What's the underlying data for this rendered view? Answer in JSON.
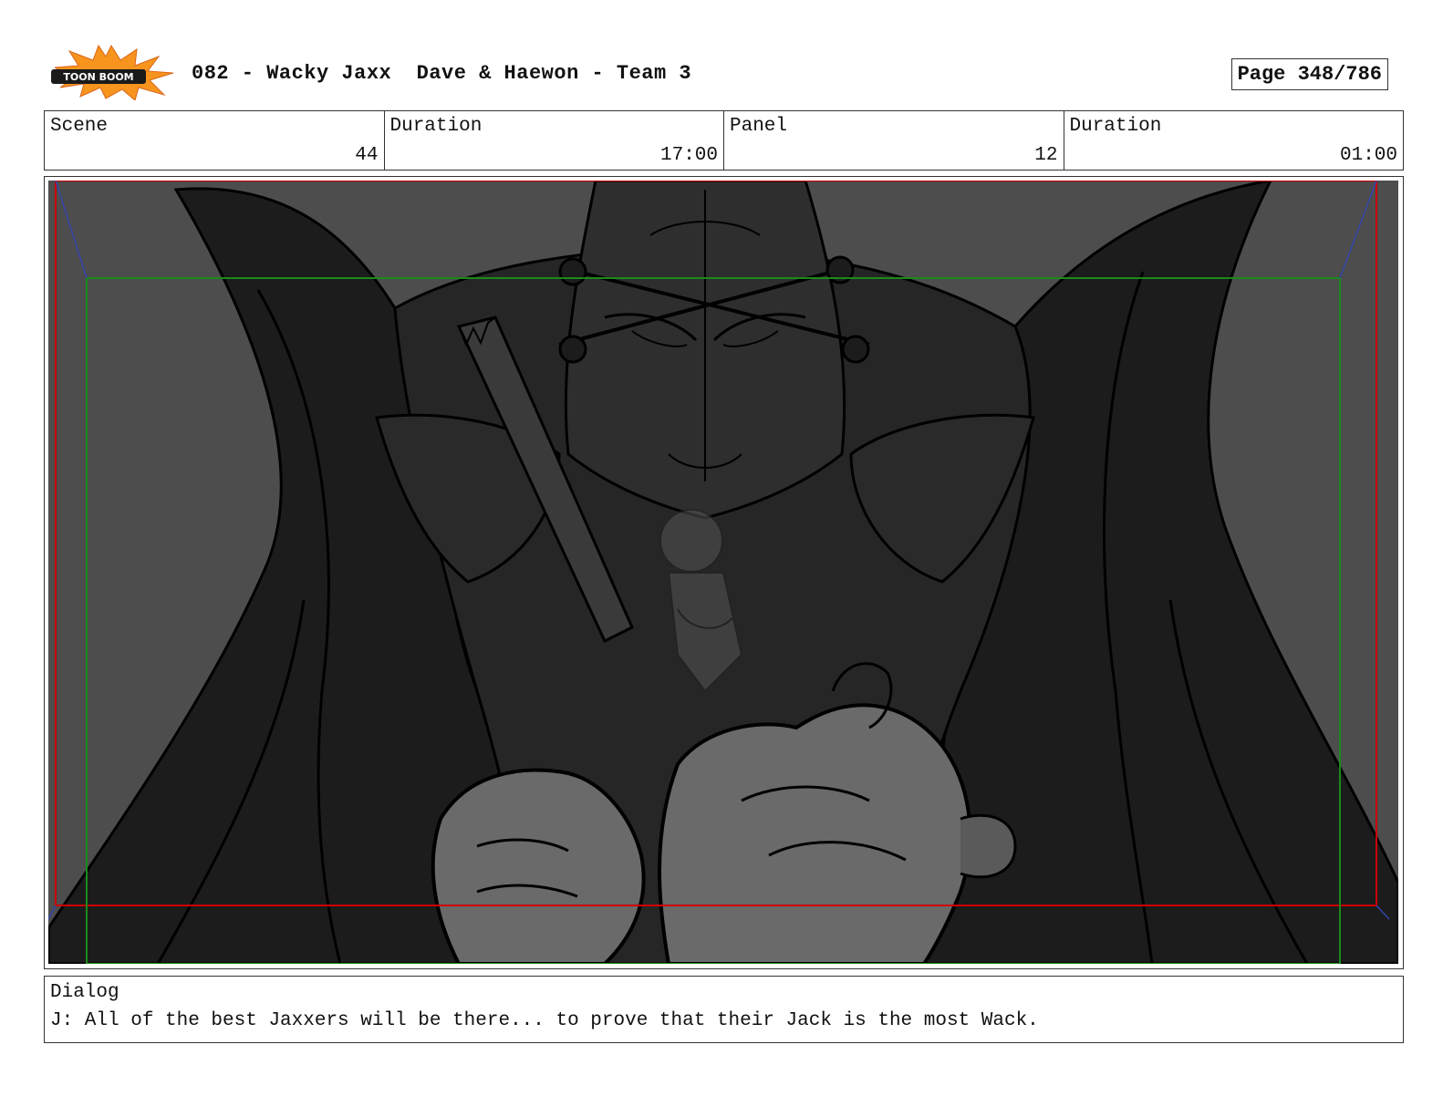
{
  "header": {
    "logo_text": "TOON BOOM",
    "project_title": "082 - Wacky Jaxx  Dave & Haewon - Team 3",
    "page_label": "Page 348/786"
  },
  "info": {
    "scene_label": "Scene",
    "scene_value": "44",
    "scene_duration_label": "Duration",
    "scene_duration_value": "17:00",
    "panel_label": "Panel",
    "panel_value": "12",
    "panel_duration_label": "Duration",
    "panel_duration_value": "01:00"
  },
  "dialog": {
    "label": "Dialog",
    "text": "J: All of the best Jaxxers will be there... to prove that their Jack is the most Wack."
  },
  "colors": {
    "logo_burst": "#f7941d",
    "logo_badge": "#1a1a1a",
    "safe_area_red": "#cc0000",
    "action_safe_green": "#1a8a1a",
    "camera_blue": "#3344aa",
    "panel_bg": "#4d4d4d"
  }
}
